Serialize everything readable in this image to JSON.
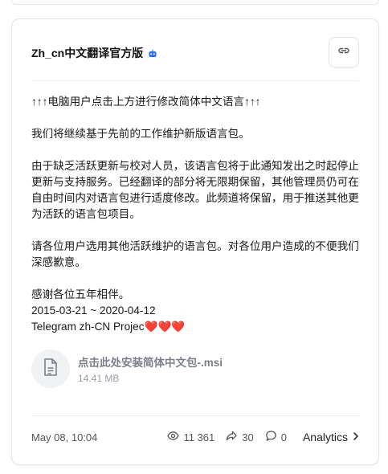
{
  "channel": {
    "name": "Zh_cn中文翻译官方版"
  },
  "post": {
    "lines": [
      "↑↑↑电脑用户点击上方进行修改简体中文语言↑↑↑",
      "",
      "我们将继续基于先前的工作维护新版语言包。",
      "",
      "由于缺乏活跃更新与校对人员，该语言包将于此通知发出之时起停止更新与支持服务。已经翻译的部分将无限期保留，其他管理员仍可在自由时间内对语言包进行适度修改。此频道将保留，用于推送其他更为活跃的语言包项目。",
      "",
      "请各位用户选用其他活跃维护的语言包。对各位用户造成的不便我们深感歉意。",
      "",
      "感谢各位五年相伴。",
      "2015-03-21 ~ 2020-04-12"
    ],
    "signature": "Telegram zh-CN Projec",
    "hearts": "❤️❤️❤️"
  },
  "attachment": {
    "name": "点击此处安装简体中文包-.msi",
    "size": "14.41 MB"
  },
  "footer": {
    "date": "May 08, 10:04",
    "views": "11 361",
    "shares": "30",
    "comments": "0",
    "analytics_label": "Analytics"
  },
  "icons": {
    "bot": "bot-icon",
    "link": "link-icon",
    "file": "document-icon",
    "views": "eye-icon",
    "shares": "share-icon",
    "comments": "comment-icon",
    "chevron": "chevron-right-icon"
  },
  "colors": {
    "accent": "#2f6fe4",
    "heart": "#e0245e"
  }
}
